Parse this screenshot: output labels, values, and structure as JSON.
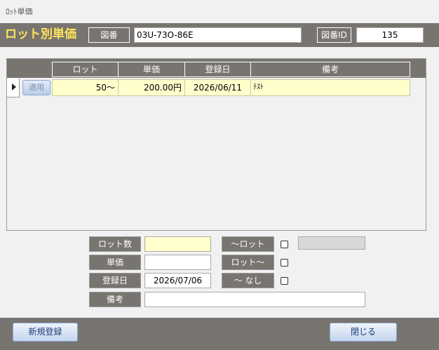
{
  "window": {
    "title": "ﾛｯﾄ単価"
  },
  "header": {
    "title": "ロット別単価",
    "drawing_label": "図番",
    "drawing_value": "03U-73O-86E",
    "drawing_id_label": "図番ID",
    "drawing_id_value": "135"
  },
  "table": {
    "columns": [
      "ロット",
      "単価",
      "登録日",
      "備考"
    ],
    "rows": [
      {
        "apply_label": "適用",
        "lot": "50～",
        "price": "200.00円",
        "date": "2026/06/11",
        "note": "ﾃｽﾄ"
      }
    ]
  },
  "form": {
    "lot_count_label": "ロット数",
    "lot_count_value": "",
    "price_label": "単価",
    "price_value": "",
    "date_label": "登録日",
    "date_value": "2026/07/06",
    "note_label": "備考",
    "note_value": "",
    "to_lot_label": "～ロット",
    "lot_to_label": "ロット～",
    "none_label": "～ なし"
  },
  "footer": {
    "new_button": "新規登録",
    "close_button": "閉じる"
  },
  "colors": {
    "band": "#787470",
    "title_accent": "#ffe55c",
    "row_highlight": "#ffffcc"
  }
}
